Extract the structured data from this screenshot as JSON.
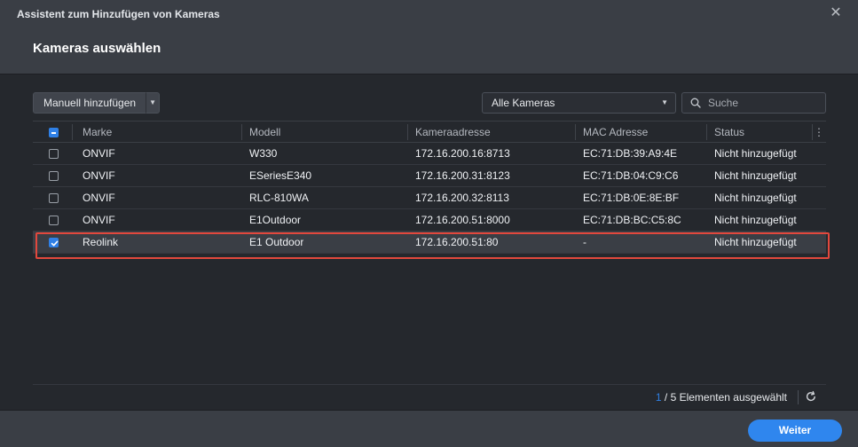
{
  "window": {
    "title": "Assistent zum Hinzufügen von Kameras",
    "close_icon": "close-icon"
  },
  "page": {
    "title": "Kameras auswählen"
  },
  "toolbar": {
    "manual_add_label": "Manuell hinzufügen",
    "filter_selected": "Alle Kameras",
    "search_placeholder": "Suche"
  },
  "table": {
    "columns": [
      "Marke",
      "Modell",
      "Kameraadresse",
      "MAC Adresse",
      "Status"
    ],
    "rows": [
      {
        "marke": "ONVIF",
        "modell": "W330",
        "adresse": "172.16.200.16:8713",
        "mac": "EC:71:DB:39:A9:4E",
        "status": "Nicht hinzugefügt",
        "checked": false
      },
      {
        "marke": "ONVIF",
        "modell": "ESeriesE340",
        "adresse": "172.16.200.31:8123",
        "mac": "EC:71:DB:04:C9:C6",
        "status": "Nicht hinzugefügt",
        "checked": false
      },
      {
        "marke": "ONVIF",
        "modell": "RLC-810WA",
        "adresse": "172.16.200.32:8113",
        "mac": "EC:71:DB:0E:8E:BF",
        "status": "Nicht hinzugefügt",
        "checked": false
      },
      {
        "marke": "ONVIF",
        "modell": "E1Outdoor",
        "adresse": "172.16.200.51:8000",
        "mac": "EC:71:DB:BC:C5:8C",
        "status": "Nicht hinzugefügt",
        "checked": false
      },
      {
        "marke": "Reolink",
        "modell": "E1 Outdoor",
        "adresse": "172.16.200.51:80",
        "mac": "-",
        "status": "Nicht hinzugefügt",
        "checked": true
      }
    ]
  },
  "selection": {
    "selected": "1",
    "suffix": "/ 5 Elementen ausgewählt"
  },
  "footer": {
    "next_label": "Weiter"
  },
  "colors": {
    "accent": "#2f86ee",
    "highlight": "#e2483d"
  }
}
